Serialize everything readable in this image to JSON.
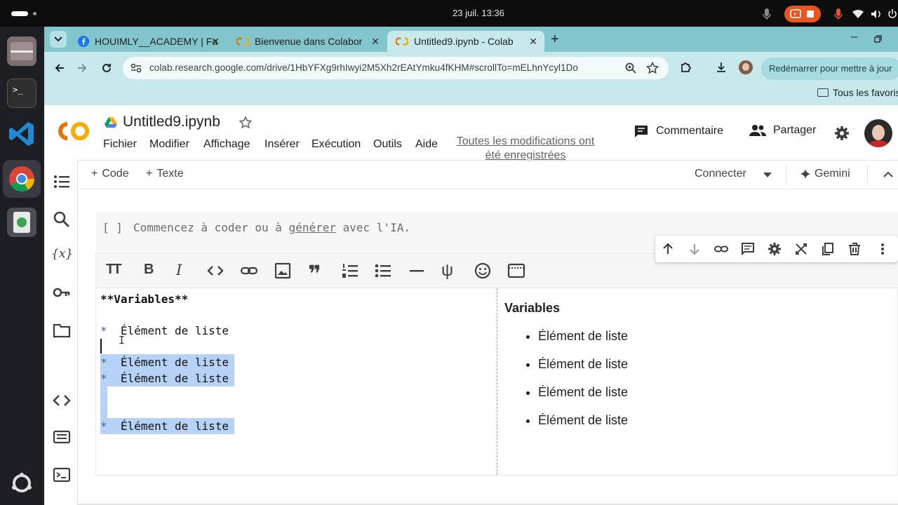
{
  "os": {
    "clock": "23 juil.  13:36"
  },
  "browser": {
    "tabs": [
      {
        "title": "HOUIMLY__ACADEMY | Fa",
        "icon": "facebook-icon"
      },
      {
        "title": "Bienvenue dans Colabor",
        "icon": "colab-icon"
      },
      {
        "title": "Untitled9.ipynb - Colab",
        "icon": "colab-icon",
        "active": true
      }
    ],
    "url": "colab.research.google.com/drive/1HbYFXg9rhIwyi2M5Xh2rEAtYmku4fKHM#scrollTo=mELhnYcyl1Do",
    "relaunch_label": "Redémarrer pour mettre à jour",
    "bookmarks_label": "Tous les favoris"
  },
  "colab": {
    "logo": "CO",
    "notebook_title": "Untitled9.ipynb",
    "menu": [
      "Fichier",
      "Modifier",
      "Affichage",
      "Insérer",
      "Exécution",
      "Outils",
      "Aide"
    ],
    "saved_status": "Toutes les modifications ont été enregistrées",
    "comment_label": "Commentaire",
    "share_label": "Partager",
    "add_code_label": "Code",
    "add_text_label": "Texte",
    "connect_label": "Connecter",
    "gemini_label": "Gemini",
    "code_cell": {
      "brackets": "[ ]",
      "placeholder_start": "Commencez à coder ou à ",
      "placeholder_link": "générer",
      "placeholder_end": " avec l'IA."
    },
    "text_cell": {
      "editor_lines": [
        "**Variables**",
        "",
        "Élément de liste",
        "",
        "Élément de liste",
        "Élément de liste",
        "",
        "",
        "Élément de liste"
      ],
      "bullet_marker": "*",
      "preview_heading": "Variables",
      "preview_items": [
        "Élément de liste",
        "Élément de liste",
        "Élément de liste",
        "Élément de liste"
      ]
    }
  },
  "colors": {
    "tabstrip": "#82c5cd",
    "addressbar": "#c8e9ec",
    "colab_orange": "#f9ab00",
    "selection": "#b6d3f7"
  }
}
